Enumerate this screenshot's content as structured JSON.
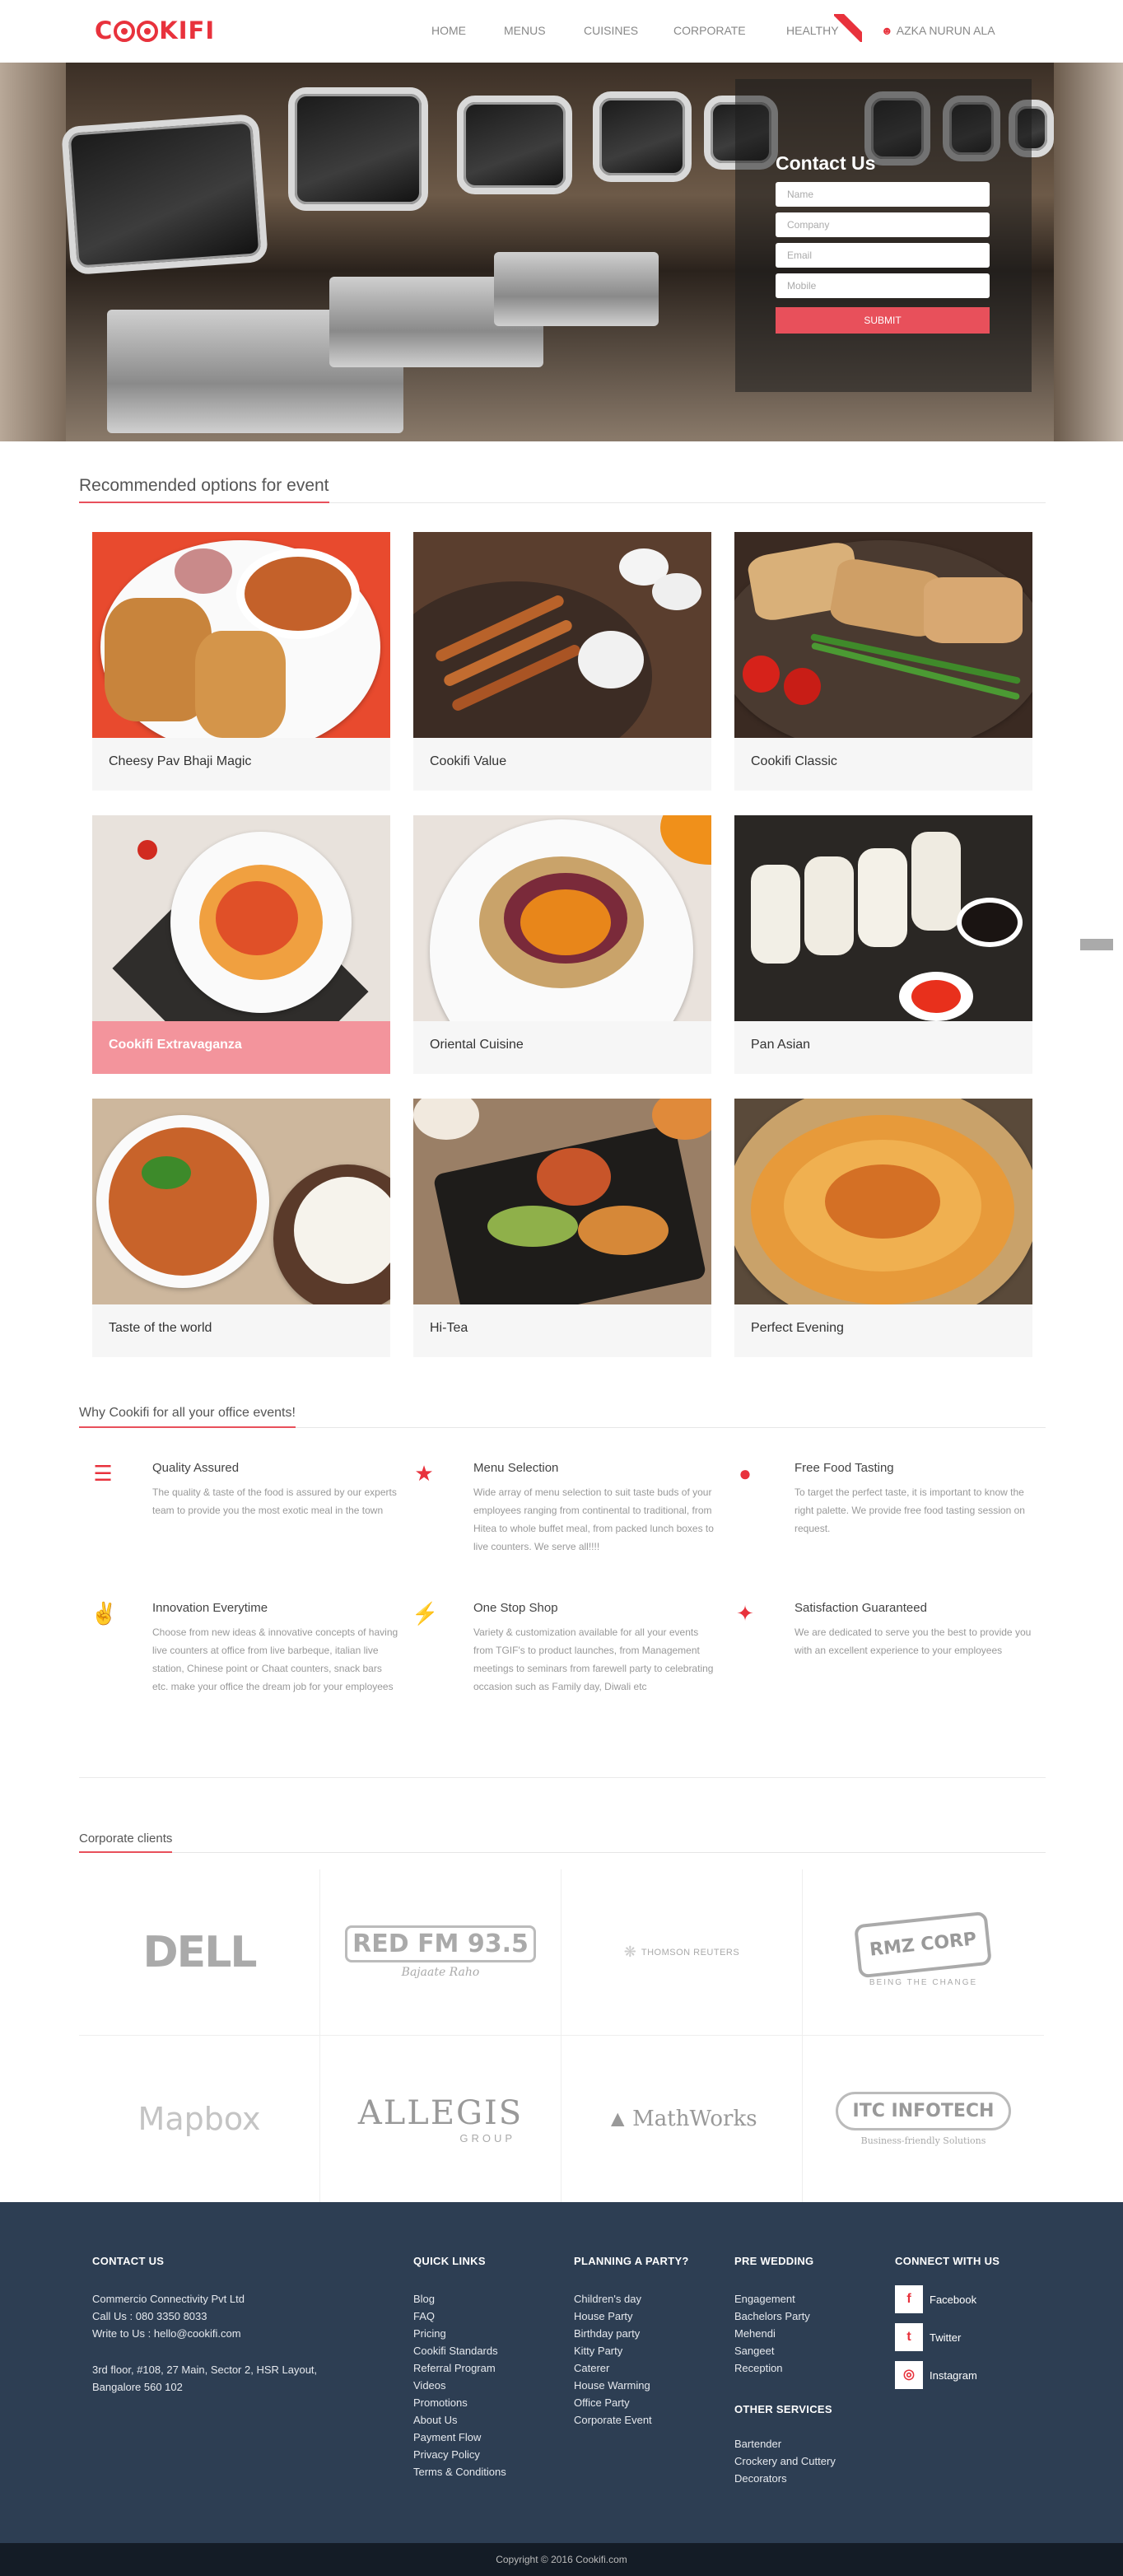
{
  "header": {
    "logo": "COOKIFI",
    "nav": [
      {
        "label": "HOME"
      },
      {
        "label": "MENUS"
      },
      {
        "label": "CUISINES"
      },
      {
        "label": "CORPORATE"
      },
      {
        "label": "HEALTHY"
      }
    ],
    "user_name": "AZKA NURUN ALA",
    "user_icon": "user-icon"
  },
  "hero": {
    "contact_title": "Contact Us",
    "fields": {
      "name_placeholder": "Name",
      "company_placeholder": "Company",
      "email_placeholder": "Email",
      "mobile_placeholder": "Mobile"
    },
    "submit_label": "SUBMIT"
  },
  "recommended": {
    "heading": "Recommended options for event",
    "cards": [
      {
        "label": "Cheesy Pav Bhaji Magic"
      },
      {
        "label": "Cookifi Value"
      },
      {
        "label": "Cookifi Classic"
      },
      {
        "label": "Cookifi Extravaganza"
      },
      {
        "label": "Oriental Cuisine"
      },
      {
        "label": "Pan Asian"
      },
      {
        "label": "Taste of the world"
      },
      {
        "label": "Hi-Tea"
      },
      {
        "label": "Perfect Evening"
      }
    ]
  },
  "why": {
    "heading": "Why Cookifi for all your office events!",
    "features": [
      {
        "icon": "list-icon",
        "title": "Quality Assured",
        "text": "The quality & taste of the food is assured by our experts team to provide you the most exotic meal in the town"
      },
      {
        "icon": "star-icon",
        "title": "Menu Selection",
        "text": "Wide array of menu selection to suit taste buds of your employees ranging from continental to traditional, from Hitea to whole buffet meal, from packed lunch boxes to live counters. We serve all!!!!"
      },
      {
        "icon": "user-icon",
        "title": "Free Food Tasting",
        "text": "To target the perfect taste, it is important to know the right palette. We provide free food tasting session on request."
      },
      {
        "icon": "peace-hand-icon",
        "title": "Innovation Everytime",
        "text": "Choose from new ideas & innovative concepts of having live counters at office from live barbeque, italian live station, Chinese point or Chaat counters, snack bars etc. make your office the dream job for your employees"
      },
      {
        "icon": "bolt-icon",
        "title": "One Stop Shop",
        "text": "Variety & customization available for all your events from TGIF's to product launches, from Management meetings to seminars from farewell party to celebrating occasion such as Family day, Diwali etc"
      },
      {
        "icon": "magic-wand-icon",
        "title": "Satisfaction Guaranteed",
        "text": "We are dedicated to serve you the best to provide you with an excellent experience to your employees"
      }
    ]
  },
  "clients": {
    "heading": "Corporate clients",
    "logos": [
      {
        "name": "DELL"
      },
      {
        "name": "RED FM 93.5",
        "tagline": "Bajaate Raho"
      },
      {
        "name": "THOMSON REUTERS"
      },
      {
        "name": "RMZ CORP",
        "tagline": "BEING THE CHANGE"
      },
      {
        "name": "Mapbox"
      },
      {
        "name": "ALLEGIS",
        "tagline": "GROUP"
      },
      {
        "name": "MathWorks"
      },
      {
        "name": "ITC INFOTECH",
        "tagline": "Business-friendly Solutions"
      }
    ]
  },
  "footer": {
    "contact": {
      "heading": "CONTACT US",
      "company": "Commercio Connectivity Pvt Ltd",
      "call": "Call Us : 080 3350 8033",
      "write": "Write to Us : hello@cookifi.com",
      "address1": "3rd floor, #108, 27 Main, Sector 2, HSR Layout,",
      "address2": "Bangalore 560 102"
    },
    "quick_links": {
      "heading": "QUICK LINKS",
      "items": [
        "Blog",
        "FAQ",
        "Pricing",
        "Cookifi Standards",
        "Referral Program",
        "Videos",
        "Promotions",
        "About Us",
        "Payment Flow",
        "Privacy Policy",
        "Terms & Conditions"
      ]
    },
    "planning": {
      "heading": "PLANNING A PARTY?",
      "items": [
        "Children's day",
        "House Party",
        "Birthday party",
        "Kitty Party",
        "Caterer",
        "House Warming",
        "Office Party",
        "Corporate Event"
      ]
    },
    "pre_wedding": {
      "heading": "PRE WEDDING",
      "items": [
        "Engagement",
        "Bachelors Party",
        "Mehendi",
        "Sangeet",
        "Reception"
      ]
    },
    "other": {
      "heading": "OTHER SERVICES",
      "items": [
        "Bartender",
        "Crockery and Cuttery",
        "Decorators"
      ]
    },
    "connect": {
      "heading": "CONNECT WITH US",
      "items": [
        {
          "icon": "facebook-icon",
          "glyph": "f",
          "label": "Facebook"
        },
        {
          "icon": "twitter-icon",
          "glyph": "t",
          "label": "Twitter"
        },
        {
          "icon": "instagram-icon",
          "glyph": "◎",
          "label": "Instagram"
        }
      ]
    },
    "copyright": "Copyright © 2016 Cookifi.com"
  },
  "colors": {
    "accent": "#e8323c",
    "accent_soft": "#f3949c",
    "footer_bg": "#2d3e53",
    "copyright_bg": "#141c26"
  }
}
